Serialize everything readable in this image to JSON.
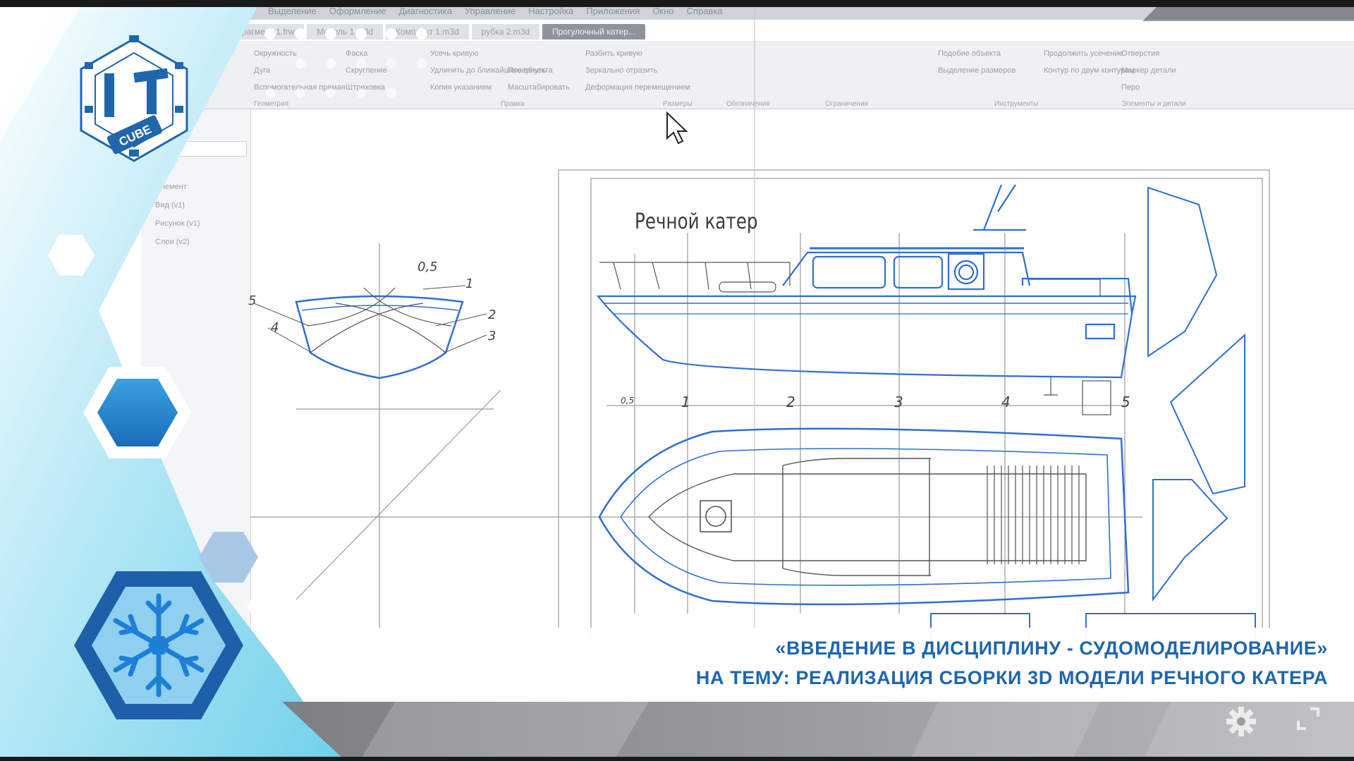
{
  "window": {
    "menu": [
      "Выделение",
      "Оформление",
      "Диагностика",
      "Управление",
      "Настройка",
      "Приложения",
      "Окно",
      "Справка"
    ],
    "tabs": [
      "Фрагмент 1.frw",
      "Модель 1.m3d",
      "Комплект 1.m3d",
      "рубка 2.m3d",
      "Прогулочный катер..."
    ],
    "active_tab_index": 4
  },
  "ribbon": {
    "commands": [
      "Окружность",
      "Дуга",
      "Вспомогательная прямая",
      "Фаска",
      "Скругление",
      "Штриховка",
      "Усечь кривую",
      "Удлинить до ближайшего объекта",
      "Копия указанием",
      "Разбить кривую",
      "Повернуть",
      "Масштабировать",
      "Зеркально отразить",
      "Деформация перемещением",
      "Подобие объекта",
      "Выделение размеров",
      "Продолжить усечение",
      "Контур по двум контурам",
      "Отверстия",
      "Маркер детали",
      "Перо"
    ],
    "groups": [
      "Геометрия",
      "Правка",
      "Размеры",
      "Обозначения",
      "Ограничения",
      "Инструменты",
      "Элементы и детали"
    ]
  },
  "panel": {
    "items": [
      "Элемент",
      "Вид (v1)",
      "Рисунок (v1)",
      "Слои (v2)"
    ]
  },
  "drawing": {
    "title": "Речной катер",
    "section_labels": [
      "0,5",
      "1",
      "2",
      "3",
      "4",
      "5"
    ],
    "station_labels": [
      "0,5",
      "1",
      "2",
      "3",
      "4",
      "5"
    ]
  },
  "caption": {
    "line1": "«ВВЕДЕНИЕ В ДИСЦИПЛИНУ - СУДОМОДЕЛИРОВАНИЕ»",
    "line2": "НА ТЕМУ: РЕАЛИЗАЦИЯ СБОРКИ  3D МОДЕЛИ РЕЧНОГО КАТЕРА"
  },
  "logo": {
    "text": "CUBE",
    "letters": "IT"
  },
  "colors": {
    "brand_blue": "#1f66ad",
    "hull_blue": "#2f6fd0",
    "light_cyan": "#7fd4ec",
    "snowflake_bg": "#8fd0f0"
  },
  "icons": [
    "settings-gear-icon",
    "fullscreen-icon",
    "snowflake-icon",
    "mouse-cursor-icon"
  ]
}
